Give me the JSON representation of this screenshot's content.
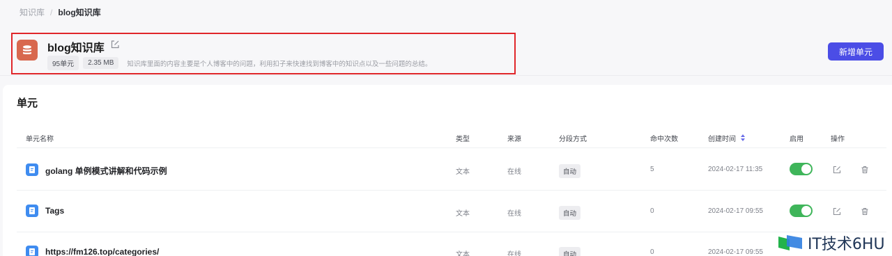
{
  "breadcrumb": {
    "root": "知识库",
    "separator": "/",
    "current": "blog知识库"
  },
  "knowledge_base": {
    "title": "blog知识库",
    "unit_count": "95单元",
    "size": "2.35 MB",
    "description": "知识库里面的内容主要是个人博客中的问题，利用扣子来快速找到博客中的知识点以及一些问题的总结。"
  },
  "actions": {
    "add_unit_label": "新增单元"
  },
  "section": {
    "title": "单元"
  },
  "table": {
    "headers": {
      "name": "单元名称",
      "type": "类型",
      "source": "来源",
      "segment": "分段方式",
      "hits": "命中次数",
      "created": "创建时间",
      "enabled": "启用",
      "ops": "操作"
    },
    "rows": [
      {
        "name": "golang 单例模式讲解和代码示例",
        "type": "文本",
        "source": "在线",
        "segment": "自动",
        "hits": "5",
        "created": "2024-02-17 11:35",
        "enabled": true
      },
      {
        "name": "Tags",
        "type": "文本",
        "source": "在线",
        "segment": "自动",
        "hits": "0",
        "created": "2024-02-17 09:55",
        "enabled": true
      },
      {
        "name": "https://fm126.top/categories/",
        "type": "文本",
        "source": "在线",
        "segment": "自动",
        "hits": "0",
        "created": "2024-02-17 09:55",
        "enabled": true
      }
    ]
  },
  "watermark": {
    "text": "IT技术6HU"
  },
  "colors": {
    "primary": "#4b4de6",
    "toggle_on": "#3fb55a",
    "kb_icon": "#d8684e",
    "doc_icon": "#3f8cf0",
    "highlight_border": "#e0262a"
  }
}
